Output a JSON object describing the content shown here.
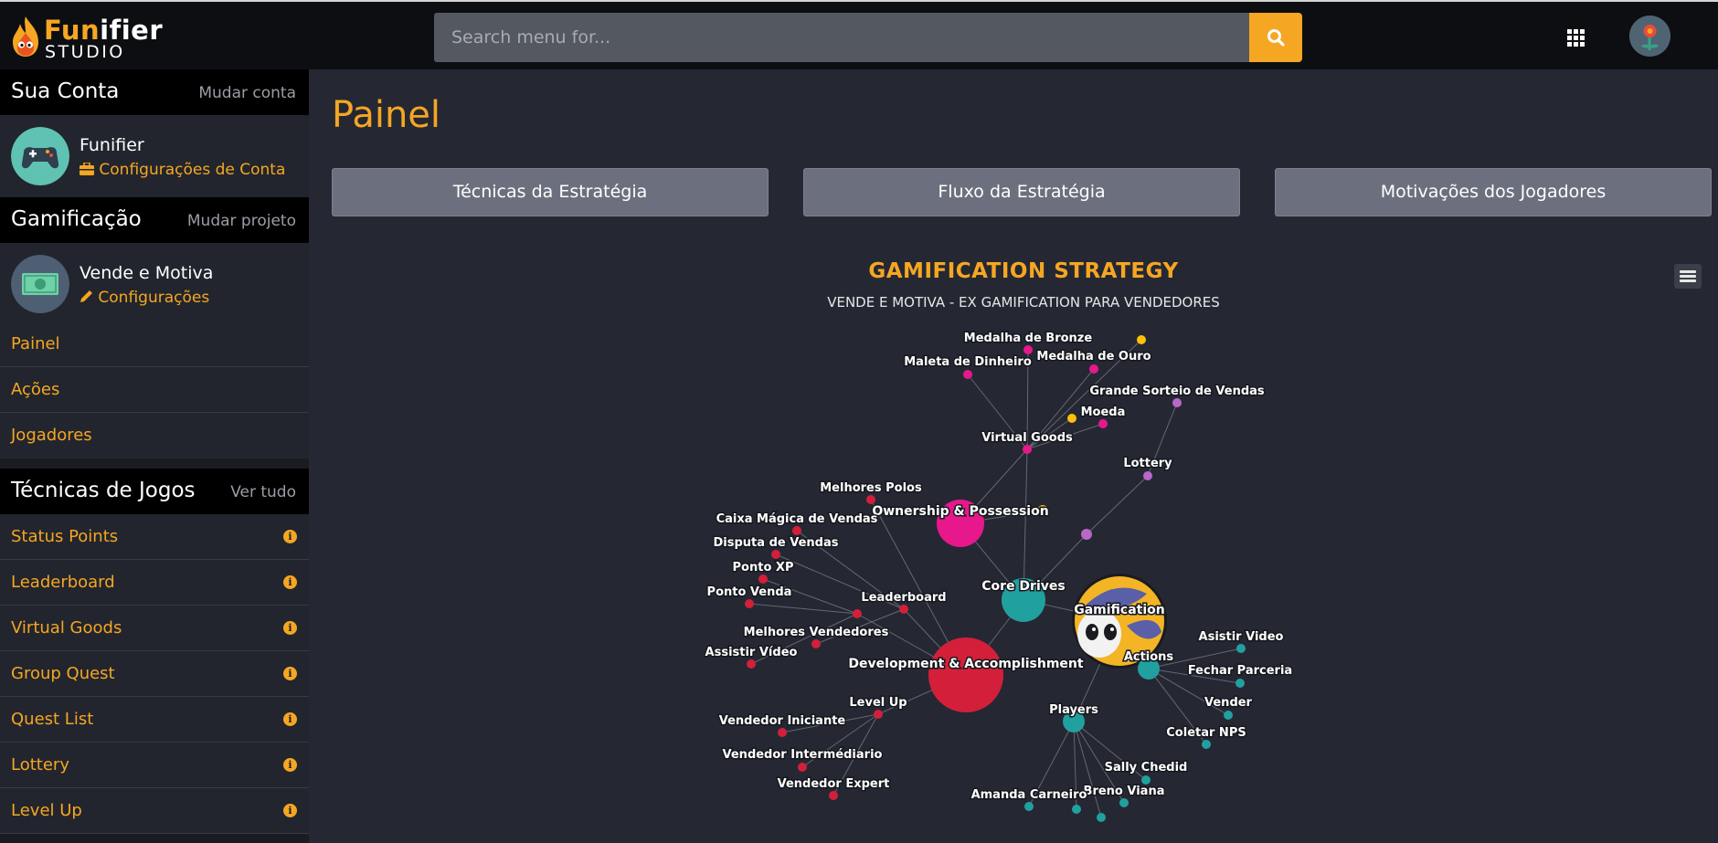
{
  "header": {
    "logo_part1": "Fun",
    "logo_part2": "ifier",
    "logo_studio": "STUDIO",
    "search_placeholder": "Search menu for...",
    "icons": {
      "search": "search-icon",
      "apps": "grid-apps-icon",
      "user": "user-avatar-icon"
    }
  },
  "sidebar": {
    "account": {
      "title": "Sua Conta",
      "change_link": "Mudar conta",
      "name": "Funifier",
      "settings_link": "Configurações de Conta",
      "avatar": "gamepad-icon"
    },
    "gamification": {
      "title": "Gamificação",
      "change_link": "Mudar projeto",
      "name": "Vende e Motiva",
      "settings_link": "Configurações",
      "avatar": "money-icon"
    },
    "nav": [
      {
        "label": "Painel"
      },
      {
        "label": "Ações"
      },
      {
        "label": "Jogadores"
      }
    ],
    "techniques": {
      "title": "Técnicas de Jogos",
      "see_all": "Ver tudo",
      "items": [
        {
          "label": "Status Points"
        },
        {
          "label": "Leaderboard"
        },
        {
          "label": "Virtual Goods"
        },
        {
          "label": "Group Quest"
        },
        {
          "label": "Quest List"
        },
        {
          "label": "Lottery"
        },
        {
          "label": "Level Up"
        }
      ]
    }
  },
  "main": {
    "title": "Painel",
    "tabs": [
      {
        "label": "Técnicas da Estratégia"
      },
      {
        "label": "Fluxo da Estratégia"
      },
      {
        "label": "Motivações dos Jogadores"
      }
    ]
  },
  "chart_data": {
    "type": "network",
    "title": "GAMIFICATION STRATEGY",
    "subtitle": "VENDE E MOTIVA - EX GAMIFICATION PARA VENDEDORES",
    "colors": {
      "teal": "#21a0a0",
      "pink": "#e6188c",
      "red": "#d41f3a",
      "orchid": "#b968c7",
      "gold": "#ffc107"
    },
    "nodes": [
      {
        "id": "gamification",
        "label": "Gamification",
        "group": "root"
      },
      {
        "id": "core_drives",
        "label": "Core Drives",
        "group": "teal"
      },
      {
        "id": "actions",
        "label": "Actions",
        "group": "teal"
      },
      {
        "id": "players",
        "label": "Players",
        "group": "teal"
      },
      {
        "id": "dev_acc",
        "label": "Development & Accomplishment",
        "group": "red"
      },
      {
        "id": "ownership",
        "label": "Ownership & Possession",
        "group": "pink"
      },
      {
        "id": "ownership_dot",
        "label": "",
        "group": "gold"
      },
      {
        "id": "unpred_dot",
        "label": "",
        "group": "orchid"
      },
      {
        "id": "virtual_goods",
        "label": "Virtual Goods",
        "group": "pink"
      },
      {
        "id": "lottery",
        "label": "Lottery",
        "group": "orchid"
      },
      {
        "id": "grande_sorteio",
        "label": "Grande Sorteio de Vendas",
        "group": "orchid"
      },
      {
        "id": "moeda",
        "label": "Moeda",
        "group": "pink"
      },
      {
        "id": "moeda_gold",
        "label": "",
        "group": "gold"
      },
      {
        "id": "medalha_ouro",
        "label": "Medalha de Ouro",
        "group": "pink"
      },
      {
        "id": "medalha_bronze",
        "label": "Medalha de Bronze",
        "group": "pink"
      },
      {
        "id": "medalha_gold",
        "label": "",
        "group": "gold"
      },
      {
        "id": "maleta",
        "label": "Maleta de Dinheiro",
        "group": "pink"
      },
      {
        "id": "leaderboard",
        "label": "Leaderboard",
        "group": "red"
      },
      {
        "id": "level_up",
        "label": "Level Up",
        "group": "red"
      },
      {
        "id": "status_pts",
        "label": "",
        "group": "red"
      },
      {
        "id": "melhores_polos",
        "label": "Melhores Polos",
        "group": "red"
      },
      {
        "id": "caixa_magica",
        "label": "Caixa Mágica de Vendas",
        "group": "red"
      },
      {
        "id": "disputa",
        "label": "Disputa de Vendas",
        "group": "red"
      },
      {
        "id": "ponto_xp",
        "label": "Ponto XP",
        "group": "red"
      },
      {
        "id": "ponto_venda",
        "label": "Ponto Venda",
        "group": "red"
      },
      {
        "id": "melhores_vend",
        "label": "Melhores Vendedores",
        "group": "red"
      },
      {
        "id": "assistir_dev",
        "label": "Assistir Vídeo",
        "group": "red"
      },
      {
        "id": "vend_iniciante",
        "label": "Vendedor Iniciante",
        "group": "red"
      },
      {
        "id": "vend_inter",
        "label": "Vendedor Intermédiario",
        "group": "red"
      },
      {
        "id": "vend_expert",
        "label": "Vendedor Expert",
        "group": "red"
      },
      {
        "id": "asistir_video",
        "label": "Asistir Video",
        "group": "teal"
      },
      {
        "id": "fechar_parceria",
        "label": "Fechar Parceria",
        "group": "teal"
      },
      {
        "id": "vender",
        "label": "Vender",
        "group": "teal"
      },
      {
        "id": "coletar_nps",
        "label": "Coletar NPS",
        "group": "teal"
      },
      {
        "id": "sally",
        "label": "Sally Chedid",
        "group": "teal"
      },
      {
        "id": "breno",
        "label": "Breno Viana",
        "group": "teal"
      },
      {
        "id": "amanda",
        "label": "Amanda Carneiro",
        "group": "teal"
      },
      {
        "id": "player_a",
        "label": "",
        "group": "teal"
      },
      {
        "id": "player_b",
        "label": "",
        "group": "teal"
      }
    ],
    "edges": [
      [
        "gamification",
        "core_drives"
      ],
      [
        "gamification",
        "actions"
      ],
      [
        "gamification",
        "players"
      ],
      [
        "core_drives",
        "dev_acc"
      ],
      [
        "core_drives",
        "ownership"
      ],
      [
        "core_drives",
        "unpred_dot"
      ],
      [
        "core_drives",
        "virtual_goods"
      ],
      [
        "ownership",
        "virtual_goods"
      ],
      [
        "ownership",
        "ownership_dot"
      ],
      [
        "virtual_goods",
        "moeda"
      ],
      [
        "virtual_goods",
        "moeda_gold"
      ],
      [
        "virtual_goods",
        "medalha_ouro"
      ],
      [
        "virtual_goods",
        "medalha_bronze"
      ],
      [
        "virtual_goods",
        "medalha_gold"
      ],
      [
        "virtual_goods",
        "maleta"
      ],
      [
        "unpred_dot",
        "lottery"
      ],
      [
        "lottery",
        "grande_sorteio"
      ],
      [
        "dev_acc",
        "leaderboard"
      ],
      [
        "dev_acc",
        "level_up"
      ],
      [
        "dev_acc",
        "status_pts"
      ],
      [
        "dev_acc",
        "melhores_polos"
      ],
      [
        "leaderboard",
        "melhores_vend"
      ],
      [
        "leaderboard",
        "caixa_magica"
      ],
      [
        "leaderboard",
        "disputa"
      ],
      [
        "status_pts",
        "assistir_dev"
      ],
      [
        "status_pts",
        "ponto_xp"
      ],
      [
        "status_pts",
        "ponto_venda"
      ],
      [
        "level_up",
        "vend_iniciante"
      ],
      [
        "level_up",
        "vend_inter"
      ],
      [
        "level_up",
        "vend_expert"
      ],
      [
        "actions",
        "asistir_video"
      ],
      [
        "actions",
        "fechar_parceria"
      ],
      [
        "actions",
        "vender"
      ],
      [
        "actions",
        "coletar_nps"
      ],
      [
        "players",
        "sally"
      ],
      [
        "players",
        "breno"
      ],
      [
        "players",
        "amanda"
      ],
      [
        "players",
        "player_a"
      ],
      [
        "players",
        "player_b"
      ]
    ]
  }
}
